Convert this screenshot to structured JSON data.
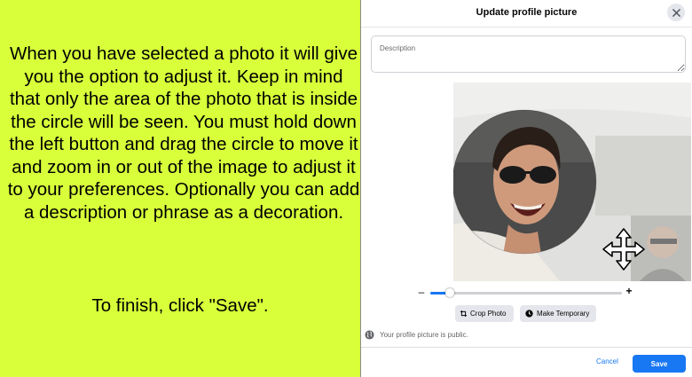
{
  "instructions": {
    "body": "When you have selected a photo it will give you the option to adjust it. Keep in mind that only the area of the photo that is inside the circle will be seen. You must hold down the left button and drag the circle to move it and zoom in or out of the image to adjust it to your preferences. Optionally you can add a description or phrase as a decoration.",
    "finish": "To finish, click \"Save\"."
  },
  "dialog": {
    "title": "Update profile picture",
    "description_placeholder": "Description",
    "zoom_minus": "–",
    "zoom_plus": "+",
    "zoom_level": 0.1,
    "crop_label": "Crop Photo",
    "temporary_label": "Make Temporary",
    "public_notice": "Your profile picture is public.",
    "cancel_label": "Cancel",
    "save_label": "Save"
  },
  "icons": {
    "close": "close-icon",
    "crop": "crop-icon",
    "clock": "clock-icon",
    "globe": "globe-icon",
    "move": "move-cursor-icon"
  },
  "colors": {
    "instruction_bg": "#d8ff3a",
    "primary": "#1877f2"
  }
}
